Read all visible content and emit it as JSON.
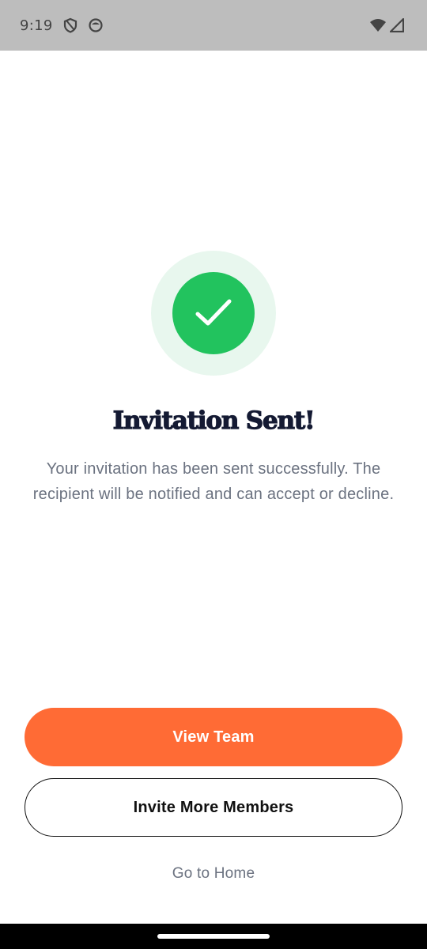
{
  "status_bar": {
    "time": "9:19",
    "icons": [
      "shield-icon",
      "face-icon",
      "wifi-icon",
      "signal-icon"
    ]
  },
  "success": {
    "icon": "checkmark-icon",
    "colors": {
      "ring": "#e8f7ee",
      "circle": "#22c35e"
    }
  },
  "title": "Invitation Sent!",
  "message": "Your invitation has been sent successfully. The recipient will be notified and can accept or decline.",
  "actions": {
    "primary_label": "View Team",
    "secondary_label": "Invite More Members",
    "link_label": "Go to Home"
  },
  "colors": {
    "accent": "#ff6b35",
    "title": "#141a33",
    "body_text": "#6b7280"
  }
}
